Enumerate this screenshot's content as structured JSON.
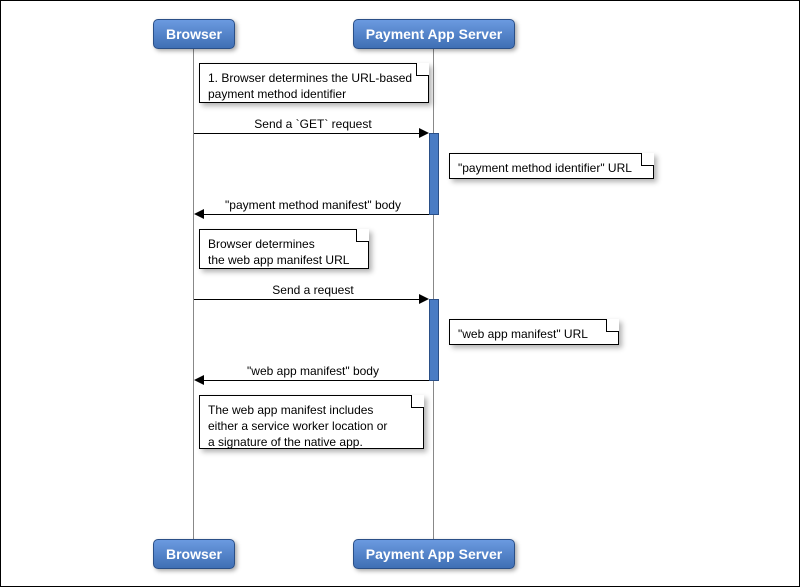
{
  "participants": {
    "left": "Browser",
    "right": "Payment App Server"
  },
  "notes": {
    "n1": "1. Browser determines the URL-based\npayment method identifier",
    "n2": "\"payment method identifier\" URL",
    "n3": "Browser determines\nthe web app manifest URL",
    "n4": "\"web app manifest\" URL",
    "n5": "The web app manifest includes\neither a service worker location or\na signature of the native app."
  },
  "messages": {
    "m1": "Send a `GET` request",
    "m2": "\"payment method manifest\" body",
    "m3": "Send a request",
    "m4": "\"web app manifest\" body"
  },
  "chart_data": {
    "type": "sequence-diagram",
    "participants": [
      "Browser",
      "Payment App Server"
    ],
    "events": [
      {
        "kind": "note",
        "over": "Browser",
        "text": "1. Browser determines the URL-based payment method identifier"
      },
      {
        "kind": "message",
        "from": "Browser",
        "to": "Payment App Server",
        "text": "Send a `GET` request"
      },
      {
        "kind": "note",
        "over": "Payment App Server",
        "side": "right",
        "text": "\"payment method identifier\" URL"
      },
      {
        "kind": "message",
        "from": "Payment App Server",
        "to": "Browser",
        "text": "\"payment method manifest\" body"
      },
      {
        "kind": "note",
        "over": "Browser",
        "text": "Browser determines the web app manifest URL"
      },
      {
        "kind": "message",
        "from": "Browser",
        "to": "Payment App Server",
        "text": "Send a request"
      },
      {
        "kind": "note",
        "over": "Payment App Server",
        "side": "right",
        "text": "\"web app manifest\" URL"
      },
      {
        "kind": "message",
        "from": "Payment App Server",
        "to": "Browser",
        "text": "\"web app manifest\" body"
      },
      {
        "kind": "note",
        "over": "Browser",
        "text": "The web app manifest includes either a service worker location or a signature of the native app."
      }
    ]
  }
}
